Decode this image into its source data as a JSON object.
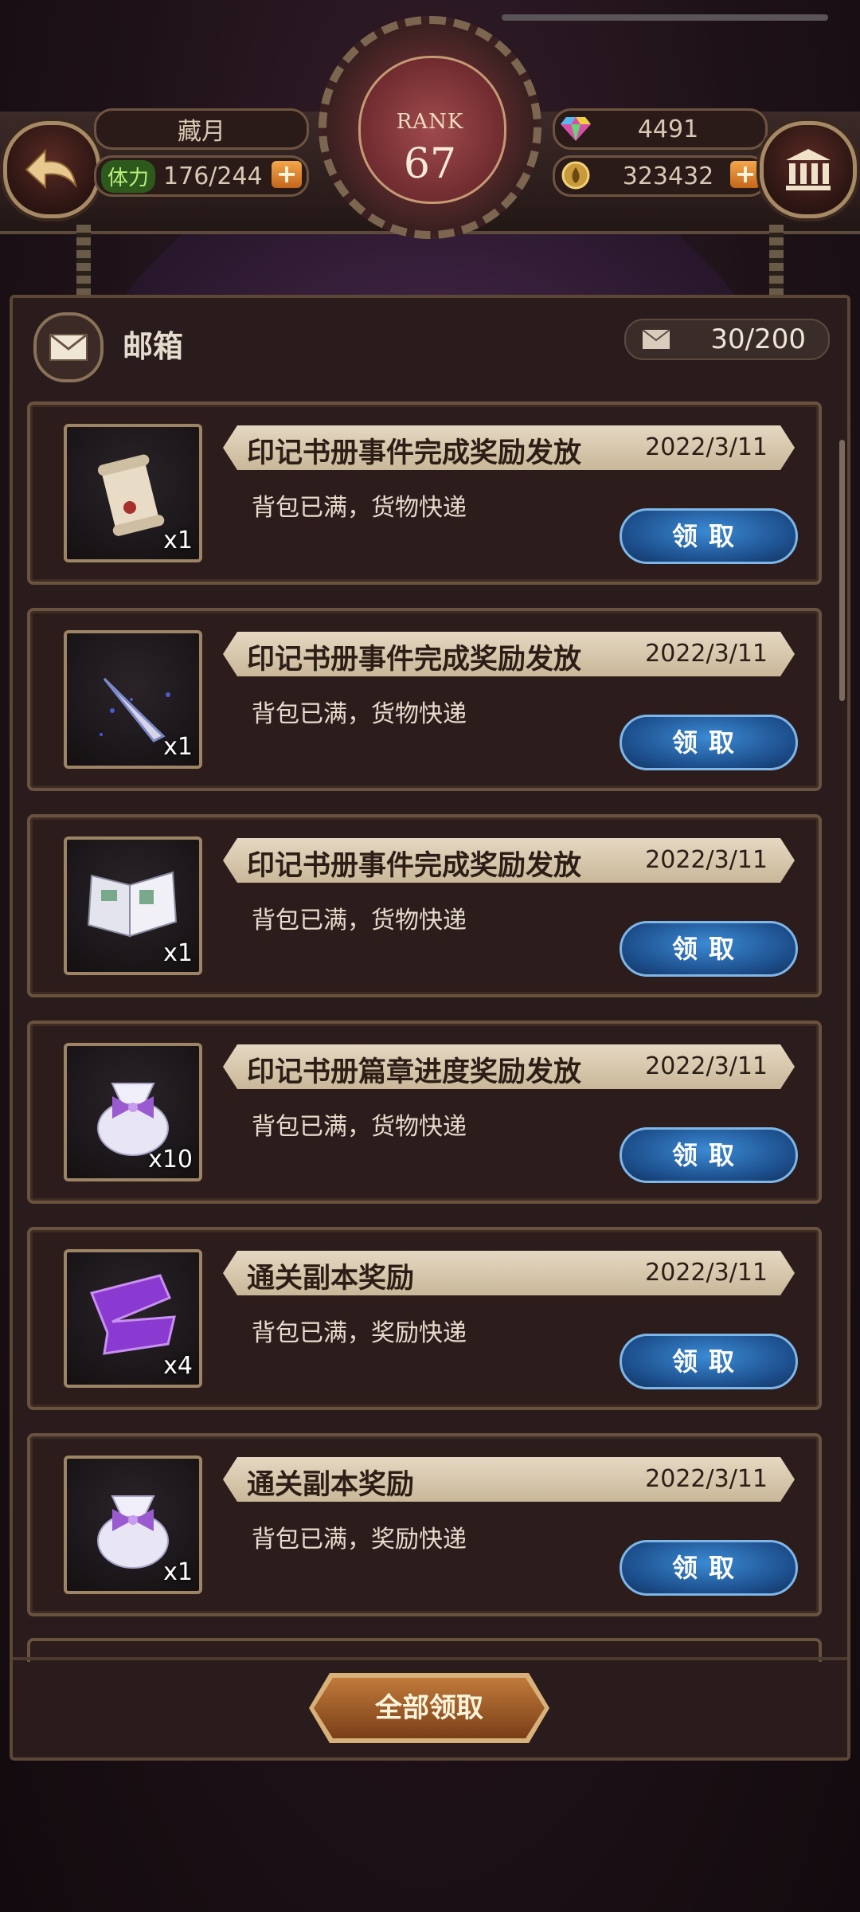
{
  "player": {
    "name": "藏月"
  },
  "stamina": {
    "label": "体力",
    "value": "176/244"
  },
  "rank": {
    "label": "RANK",
    "value": "67"
  },
  "gems": {
    "value": "4491"
  },
  "coins": {
    "value": "323432"
  },
  "mailbox": {
    "title": "邮箱",
    "count": "30/200",
    "claim_label": "领取",
    "claim_all_label": "全部领取",
    "items": [
      {
        "subject": "印记书册事件完成奖励发放",
        "date": "2022/3/11",
        "body": "背包已满，货物快递",
        "qty": "x1",
        "icon": "scroll-icon"
      },
      {
        "subject": "印记书册事件完成奖励发放",
        "date": "2022/3/11",
        "body": "背包已满，货物快递",
        "qty": "x1",
        "icon": "horn-icon"
      },
      {
        "subject": "印记书册事件完成奖励发放",
        "date": "2022/3/11",
        "body": "背包已满，货物快递",
        "qty": "x1",
        "icon": "book-icon"
      },
      {
        "subject": "印记书册篇章进度奖励发放",
        "date": "2022/3/11",
        "body": "背包已满，货物快递",
        "qty": "x10",
        "icon": "gift-bag-icon"
      },
      {
        "subject": "通关副本奖励",
        "date": "2022/3/11",
        "body": "背包已满，奖励快递",
        "qty": "x4",
        "icon": "ribbon-icon"
      },
      {
        "subject": "通关副本奖励",
        "date": "2022/3/11",
        "body": "背包已满，奖励快递",
        "qty": "x1",
        "icon": "gift-bag-icon"
      }
    ]
  }
}
